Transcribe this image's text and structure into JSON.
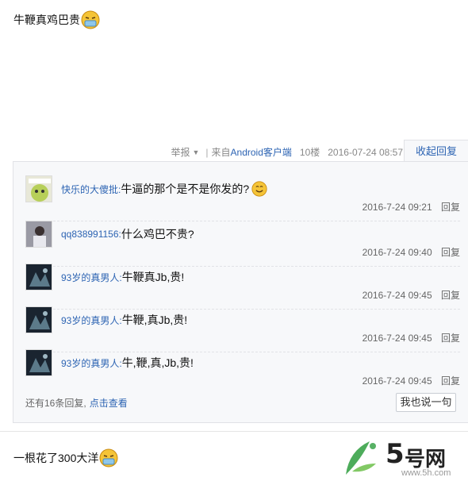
{
  "post": {
    "text": "牛鞭真鸡巴贵",
    "meta": {
      "report": "举报",
      "from": "来自",
      "client": "Android客户端",
      "floor": "10楼",
      "time": "2016-07-24 08:57"
    },
    "collapse": "收起回复"
  },
  "comments": [
    {
      "user": "快乐的大傻批:",
      "text": "牛逼的那个是不是你发的?",
      "time": "2016-7-24 09:21",
      "reply": "回复",
      "emoji": "smile-emoji"
    },
    {
      "user": "qq838991156:",
      "text": "什么鸡巴不贵?",
      "time": "2016-7-24 09:40",
      "reply": "回复"
    },
    {
      "user": "93岁的真男人:",
      "text": "牛鞭真Jb,贵!",
      "time": "2016-7-24 09:45",
      "reply": "回复"
    },
    {
      "user": "93岁的真男人:",
      "text": "牛鞭,真Jb,贵!",
      "time": "2016-7-24 09:45",
      "reply": "回复"
    },
    {
      "user": "93岁的真男人:",
      "text": "牛,鞭,真,Jb,贵!",
      "time": "2016-7-24 09:45",
      "reply": "回复"
    }
  ],
  "more": {
    "count_text": "还有16条回复,",
    "link": "点击查看"
  },
  "say_button": "我也说一句",
  "next_post": {
    "text": "一根花了300大洋"
  },
  "watermark": {
    "num": "5",
    "brand": "号网",
    "url": "www.5h.com"
  },
  "colors": {
    "link": "#2d64b3",
    "panel": "#f7f8fa",
    "border": "#e1e2e6",
    "watermark_green": "#2e9e3e"
  }
}
